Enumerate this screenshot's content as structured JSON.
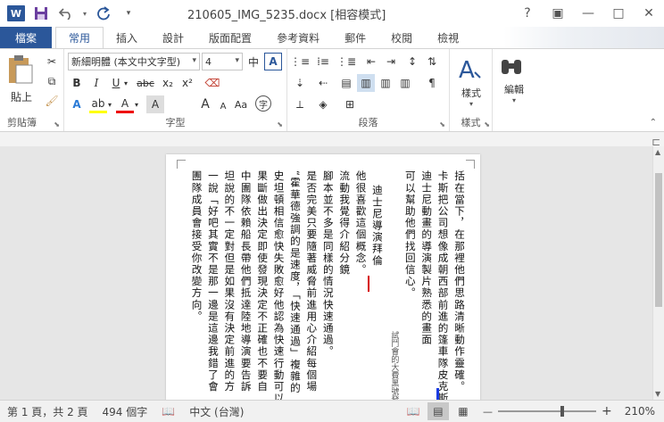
{
  "window": {
    "title": "210605_IMG_5235.docx [相容模式]",
    "app_icon": "W",
    "controls": [
      "?",
      "▣",
      "—",
      "□",
      "✕"
    ]
  },
  "tabs": {
    "file": "檔案",
    "items": [
      "常用",
      "插入",
      "設計",
      "版面配置",
      "參考資料",
      "郵件",
      "校閱",
      "檢視"
    ]
  },
  "ribbon": {
    "clipboard": {
      "label": "剪貼簿",
      "paste": "貼上"
    },
    "font": {
      "label": "字型",
      "font_name": "新細明體 (本文中文字型)",
      "font_size": "4",
      "bold": "B",
      "italic": "I",
      "underline": "U",
      "strike": "abc",
      "sub": "x₂",
      "sup": "x²",
      "font_color_a": "A",
      "grow": "A",
      "shrink": "A",
      "phonetic": "中",
      "enclose": "字",
      "clear": "A",
      "aa": "Aa"
    },
    "paragraph": {
      "label": "段落"
    },
    "styles": {
      "label": "樣式",
      "button": "樣式"
    },
    "editing": {
      "button": "編輯"
    }
  },
  "document": {
    "columns": [
      "括在當下，在那裡他們思路清晰動作靈確。",
      "卡斯把公司想像成朝西部前進的篷車隊皮克斯和",
      "迪士尼動畫的導演製片熟悉的畫面",
      "可以幫助他們找回信心。",
      "迪士尼導演拜倫",
      "他很喜歡這個概念。",
      "流動我覺得介紹分鏡",
      "腳本並不多是同樣的情況快速通過。",
      "是否完美只要隨著威脅前進用心介紹每個場",
      "“霍華德強調的是速度，「快速通過」複雜的",
      "史坦頓相信愈快失敗愈好他認為快速行動可以防",
      "果斷做出決定即使發現決定不正確也不要自",
      "中團隊依賴船長帶他們抵達陸地導演要告訴",
      "坦說的不一定對但是如果沒有決定前進的方",
      "一說「好吧其實不是那一邊是這邊我錯了會",
      "團隊成員會接受你改變方向。"
    ],
    "annotation": "試鬥會的大費黑號發",
    "annotation2": "讓團隊在時題中和其他隊聯繫"
  },
  "status": {
    "page": "第 1 頁，共 2 頁",
    "words": "494 個字",
    "language": "中文 (台灣)",
    "zoom": "210%",
    "zoom_out": "—",
    "zoom_in": "+"
  }
}
